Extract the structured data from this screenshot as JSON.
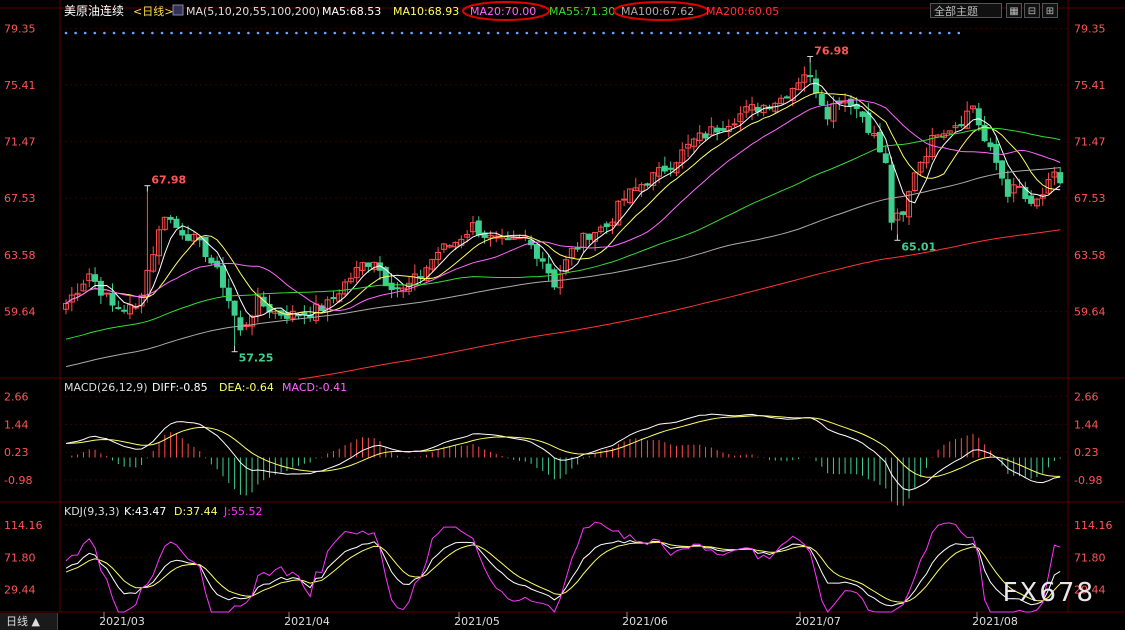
{
  "window": {
    "symbol": "美原油连续",
    "period": "<日线>",
    "theme_select": "全部主题",
    "bottom_tab": "日线 ▲",
    "watermark": "FX678"
  },
  "colors": {
    "background": "#000000",
    "up": "#ff4d4d",
    "down": "#3ecf8e",
    "ma5": "#ffffff",
    "ma10": "#ffff66",
    "ma20": "#ff66ff",
    "ma55": "#33dd33",
    "ma100": "#aaaaaa",
    "ma200": "#ff3333",
    "axis_text": "#ff5555",
    "grid": "#3a0000",
    "diff": "#ffffff",
    "dea": "#ffff66",
    "macd_up": "#ff4d4d",
    "macd_down": "#3ecf8e",
    "k": "#ffffff",
    "d": "#ffff66",
    "j": "#ff33ff",
    "highlight_circle": "#e00000"
  },
  "chart_data": [
    {
      "type": "candlestick",
      "panel": "price",
      "legend": {
        "label": "MA(5,10,20,55,100,200)",
        "values": [
          {
            "name": "MA5",
            "text": "MA5:68.53"
          },
          {
            "name": "MA10",
            "text": "MA10:68.93"
          },
          {
            "name": "MA20",
            "text": "MA20:70.00",
            "circled": true
          },
          {
            "name": "MA55",
            "text": "MA55:71.30"
          },
          {
            "name": "MA100",
            "text": "MA100:67.62",
            "circled": true
          },
          {
            "name": "MA200",
            "text": "MA200:60.05"
          }
        ]
      },
      "yticks": [
        79.35,
        75.41,
        71.47,
        67.53,
        63.58,
        59.64
      ],
      "ylim": [
        55.0,
        79.8
      ],
      "x": [
        "2021/03",
        "2021/04",
        "2021/05",
        "2021/06",
        "2021/07",
        "2021/08"
      ],
      "annotations": [
        {
          "text": "67.98",
          "value": 67.98,
          "kind": "high",
          "month_pos": 0.45
        },
        {
          "text": "57.25",
          "value": 57.25,
          "kind": "low",
          "month_pos": 0.85
        },
        {
          "text": "76.98",
          "value": 76.98,
          "kind": "high",
          "month_pos": 4.05
        },
        {
          "text": "65.01",
          "value": 65.01,
          "kind": "low",
          "month_pos": 4.4
        }
      ],
      "close_anchors": [
        [
          0,
          60.2
        ],
        [
          4,
          62.3
        ],
        [
          8,
          60.0
        ],
        [
          12,
          59.8
        ],
        [
          14,
          62.5
        ],
        [
          17,
          66.5
        ],
        [
          19,
          65.5
        ],
        [
          21,
          65.0
        ],
        [
          24,
          63.8
        ],
        [
          27,
          61.6
        ],
        [
          30,
          58.2
        ],
        [
          33,
          60.3
        ],
        [
          36,
          59.6
        ],
        [
          39,
          59.4
        ],
        [
          42,
          59.6
        ],
        [
          45,
          60.1
        ],
        [
          48,
          61.6
        ],
        [
          51,
          62.9
        ],
        [
          53,
          63.3
        ],
        [
          55,
          61.8
        ],
        [
          58,
          61.1
        ],
        [
          61,
          62.2
        ],
        [
          64,
          63.8
        ],
        [
          67,
          64.5
        ],
        [
          70,
          65.6
        ],
        [
          73,
          64.7
        ],
        [
          76,
          64.3
        ],
        [
          79,
          64.7
        ],
        [
          82,
          63.3
        ],
        [
          84,
          61.6
        ],
        [
          87,
          63.8
        ],
        [
          90,
          65.1
        ],
        [
          93,
          65.6
        ],
        [
          96,
          67.5
        ],
        [
          99,
          68.5
        ],
        [
          102,
          69.3
        ],
        [
          105,
          70.3
        ],
        [
          108,
          71.5
        ],
        [
          111,
          72.2
        ],
        [
          114,
          72.9
        ],
        [
          117,
          73.6
        ],
        [
          120,
          74.0
        ],
        [
          123,
          74.5
        ],
        [
          125,
          75.3
        ],
        [
          127,
          76.3
        ],
        [
          129,
          75.2
        ],
        [
          131,
          73.5
        ],
        [
          133,
          74.5
        ],
        [
          135,
          74.3
        ],
        [
          137,
          73.3
        ],
        [
          139,
          71.8
        ],
        [
          141,
          69.8
        ],
        [
          142,
          66.0
        ],
        [
          144,
          66.2
        ],
        [
          146,
          69.5
        ],
        [
          148,
          70.8
        ],
        [
          150,
          72.3
        ],
        [
          152,
          72.5
        ],
        [
          154,
          73.0
        ],
        [
          156,
          74.0
        ],
        [
          158,
          71.5
        ],
        [
          160,
          70.0
        ],
        [
          162,
          68.0
        ],
        [
          164,
          68.2
        ],
        [
          166,
          66.8
        ],
        [
          168,
          67.8
        ],
        [
          170,
          69.0
        ],
        [
          171,
          68.6
        ]
      ]
    },
    {
      "type": "macd",
      "panel": "macd",
      "legend": {
        "label": "MACD(26,12,9)",
        "diff": "DIFF:-0.85",
        "dea": "DEA:-0.64",
        "macd": "MACD:-0.41"
      },
      "yticks": [
        2.66,
        1.44,
        0.23,
        -0.98
      ],
      "ylim": [
        -1.85,
        2.85
      ]
    },
    {
      "type": "kdj",
      "panel": "kdj",
      "legend": {
        "label": "KDJ(9,3,3)",
        "k": "K:43.47",
        "d": "D:37.44",
        "j": "J:55.52"
      },
      "yticks": [
        114.16,
        71.8,
        29.44
      ],
      "ylim": [
        0,
        126
      ]
    }
  ]
}
